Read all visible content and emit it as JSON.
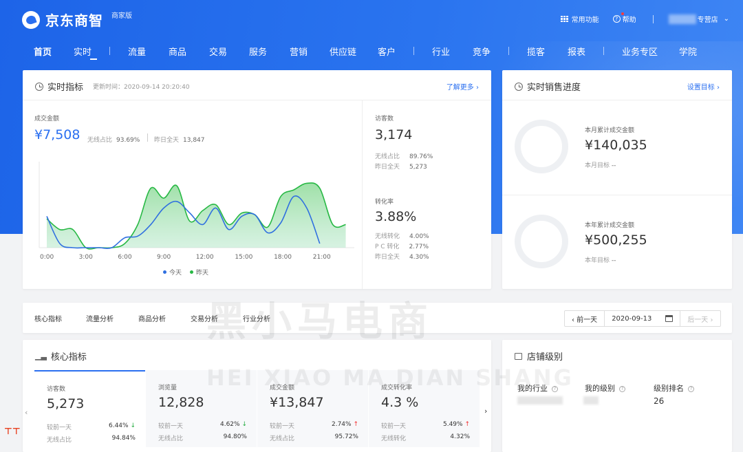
{
  "app": {
    "brand": "京东商智",
    "edition": "商家版"
  },
  "topbar": {
    "common_functions": "常用功能",
    "help": "帮助",
    "store_suffix": "专营店"
  },
  "nav": [
    {
      "label": "首页",
      "active": true
    },
    {
      "label": "实时"
    },
    {
      "label": "流量"
    },
    {
      "label": "商品"
    },
    {
      "label": "交易"
    },
    {
      "label": "服务"
    },
    {
      "label": "营销"
    },
    {
      "label": "供应链"
    },
    {
      "label": "客户"
    },
    {
      "label": "行业"
    },
    {
      "label": "竞争"
    },
    {
      "label": "揽客"
    },
    {
      "label": "报表"
    },
    {
      "label": "业务专区"
    },
    {
      "label": "学院"
    }
  ],
  "realtime": {
    "title": "实时指标",
    "update_label": "更新时间：2020-09-14 20:20:40",
    "more": "了解更多",
    "gmv_label": "成交金额",
    "gmv_value": "¥7,508",
    "wireless_ratio_label": "无线占比",
    "wireless_ratio": "93.69%",
    "yesterday_label": "昨日全天",
    "yesterday_value": "13,847",
    "visitors_label": "访客数",
    "visitors_value": "3,174",
    "visitors_wireless_label": "无线占比",
    "visitors_wireless": "89.76%",
    "visitors_yesterday_label": "昨日全天",
    "visitors_yesterday": "5,273",
    "conversion_label": "转化率",
    "conversion_value": "3.88%",
    "conv_wireless_label": "无线转化",
    "conv_wireless": "4.00%",
    "conv_pc_label": "P C 转化",
    "conv_pc": "2.77%",
    "conv_yesterday_label": "昨日全天",
    "conv_yesterday": "4.30%"
  },
  "chart_data": {
    "type": "area",
    "x_ticks": [
      "0:00",
      "3:00",
      "6:00",
      "9:00",
      "12:00",
      "15:00",
      "18:00",
      "21:00"
    ],
    "x": [
      0,
      1,
      2,
      3,
      4,
      5,
      6,
      7,
      8,
      9,
      10,
      11,
      12,
      13,
      14,
      15,
      16,
      17,
      18,
      19,
      20,
      21,
      22,
      23
    ],
    "xlim": [
      0,
      23.5
    ],
    "ylim": [
      0,
      100
    ],
    "series": [
      {
        "name": "今天",
        "color": "#2f6fe0",
        "fill": false,
        "values": [
          38,
          5,
          0,
          0,
          0,
          0,
          12,
          14,
          28,
          48,
          56,
          42,
          28,
          48,
          22,
          38,
          40,
          18,
          30,
          62,
          48,
          5,
          null,
          null
        ]
      },
      {
        "name": "昨天",
        "color": "#27b844",
        "fill": true,
        "values": [
          35,
          22,
          22,
          0,
          0,
          0,
          5,
          28,
          72,
          60,
          75,
          32,
          45,
          52,
          28,
          42,
          40,
          25,
          62,
          70,
          78,
          72,
          28,
          28
        ]
      }
    ],
    "legend": "bottom-center",
    "grid": false
  },
  "sales_progress": {
    "title": "实时销售进度",
    "set_goal": "设置目标",
    "month_label": "本月累计成交金额",
    "month_value": "¥140,035",
    "month_target_label": "本月目标",
    "month_target": "--",
    "year_label": "本年累计成交金额",
    "year_value": "¥500,255",
    "year_target_label": "本年目标",
    "year_target": "--"
  },
  "analysis_tabs": [
    "核心指标",
    "流量分析",
    "商品分析",
    "交易分析",
    "行业分析"
  ],
  "date_picker": {
    "prev": "‹ 前一天",
    "date": "2020-09-13",
    "next": "后一天 ›"
  },
  "core": {
    "title": "核心指标",
    "metrics": [
      {
        "label": "访客数",
        "value": "5,273",
        "cmp_label": "较前一天",
        "cmp": "6.44%",
        "dir": "down",
        "ratio_label": "无线占比",
        "ratio": "94.84%"
      },
      {
        "label": "浏览量",
        "value": "12,828",
        "cmp_label": "较前一天",
        "cmp": "4.62%",
        "dir": "down",
        "ratio_label": "无线占比",
        "ratio": "94.80%"
      },
      {
        "label": "成交金额",
        "value": "¥13,847",
        "cmp_label": "较前一天",
        "cmp": "2.74%",
        "dir": "up",
        "ratio_label": "无线占比",
        "ratio": "95.72%"
      },
      {
        "label": "成交转化率",
        "value": "4.3 %",
        "cmp_label": "较前一天",
        "cmp": "5.49%",
        "dir": "up",
        "ratio_label": "无线转化",
        "ratio": "4.32%"
      }
    ]
  },
  "store_level": {
    "title": "店铺级别",
    "industry_label": "我的行业",
    "level_label": "我的级别",
    "rank_label": "级别排名",
    "rank_value": "26"
  },
  "watermark": {
    "cn": "黑小马电商",
    "en": "HEI XIAO MA DIAN SHANG"
  }
}
